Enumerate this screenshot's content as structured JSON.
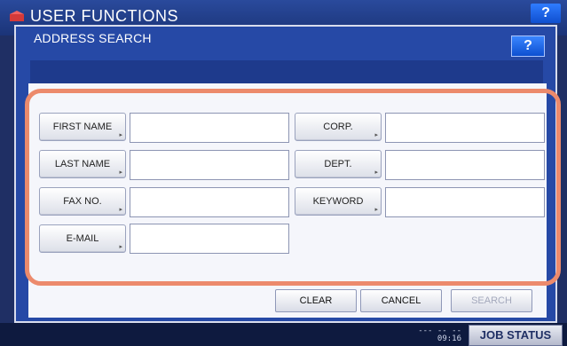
{
  "background_window": {
    "title": "USER FUNCTIONS",
    "help_label": "?",
    "time_line1": "--- -- --",
    "time_line2": "09:16",
    "job_status_label": "JOB STATUS"
  },
  "dialog": {
    "title": "ADDRESS SEARCH",
    "help_label": "?",
    "fields_left": [
      {
        "label": "FIRST NAME",
        "value": ""
      },
      {
        "label": "LAST NAME",
        "value": ""
      },
      {
        "label": "FAX NO.",
        "value": ""
      },
      {
        "label": "E-MAIL",
        "value": ""
      }
    ],
    "fields_right": [
      {
        "label": "CORP.",
        "value": ""
      },
      {
        "label": "DEPT.",
        "value": ""
      },
      {
        "label": "KEYWORD",
        "value": ""
      }
    ],
    "buttons": {
      "clear": "CLEAR",
      "cancel": "CANCEL",
      "search": "SEARCH"
    }
  },
  "colors": {
    "highlight_border": "#ec8a6c",
    "dialog_blue": "#2649a6"
  }
}
